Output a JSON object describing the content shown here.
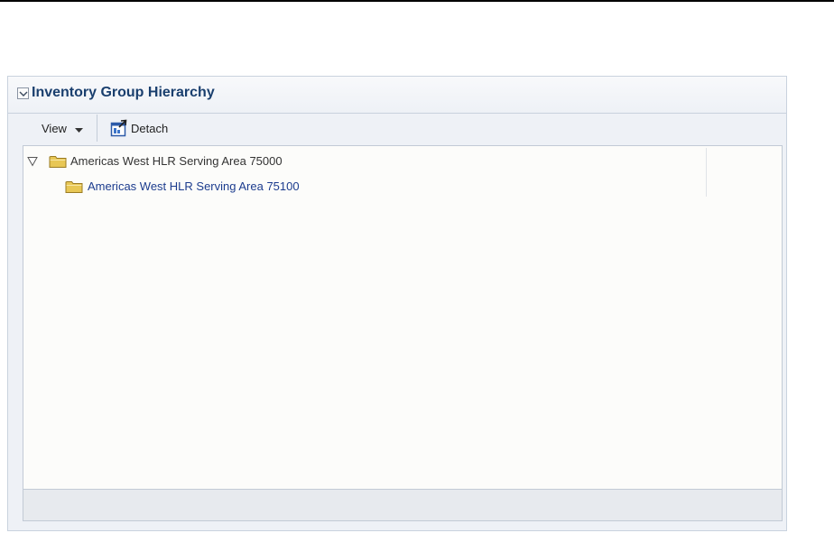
{
  "panel": {
    "title": "Inventory Group Hierarchy",
    "disclose_icon": "chevron-down-icon"
  },
  "toolbar": {
    "view_label": "View",
    "view_icon": "caret-down-icon",
    "detach_label": "Detach",
    "detach_icon": "detach-icon"
  },
  "tree": {
    "nodes": [
      {
        "label": "Americas West HLR Serving Area 75000",
        "expanded": true,
        "icon": "folder-icon",
        "children": [
          {
            "label": "Americas West HLR Serving Area 75100",
            "icon": "folder-icon",
            "selected_link": true
          }
        ]
      }
    ]
  },
  "colors": {
    "title": "#1a3f6e",
    "link": "#1c3c8e",
    "panel_bg": "#eef1f6",
    "tree_bg": "#fcfcfa",
    "folder": "#e8c755"
  }
}
